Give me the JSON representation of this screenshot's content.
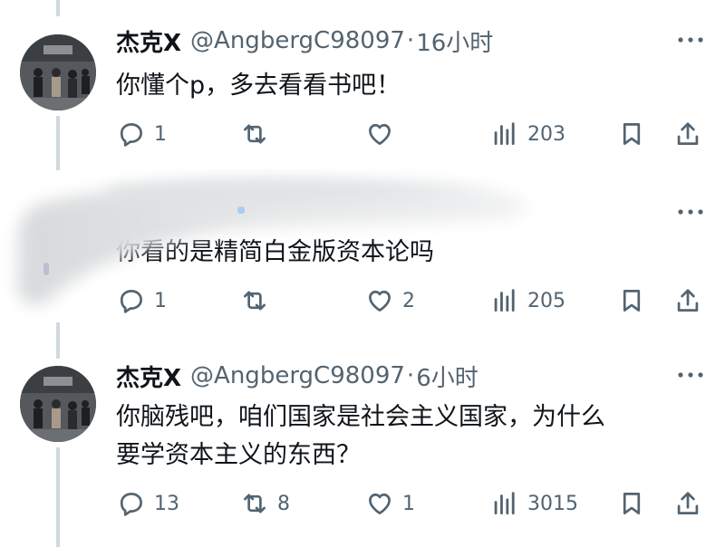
{
  "colors": {
    "text": "#0f1419",
    "muted": "#536471",
    "thread_line": "#cfd9de",
    "background": "#ffffff"
  },
  "tweets": [
    {
      "author_name": "杰克X",
      "handle": "@AngbergC98097",
      "separator": "·",
      "time": "16小时",
      "text_lines": [
        "你懂个p，多去看看书吧！"
      ],
      "replies": "1",
      "retweets": "",
      "likes": "",
      "views": "203"
    },
    {
      "author_name": "",
      "handle": "",
      "separator": "",
      "time": "",
      "text_lines": [
        "你看的是精简白金版资本论吗"
      ],
      "replies": "1",
      "retweets": "",
      "likes": "2",
      "views": "205"
    },
    {
      "author_name": "杰克X",
      "handle": "@AngbergC98097",
      "separator": "·",
      "time": "6小时",
      "text_lines": [
        "你脑残吧，咱们国家是社会主义国家，为什么",
        "要学资本主义的东西？"
      ],
      "replies": "13",
      "retweets": "8",
      "likes": "1",
      "views": "3015"
    }
  ],
  "icons": {
    "reply": "reply-icon",
    "retweet": "retweet-icon",
    "like": "heart-icon",
    "views": "views-chart-icon",
    "bookmark": "bookmark-icon",
    "share": "share-icon",
    "more": "more-dots-icon"
  }
}
